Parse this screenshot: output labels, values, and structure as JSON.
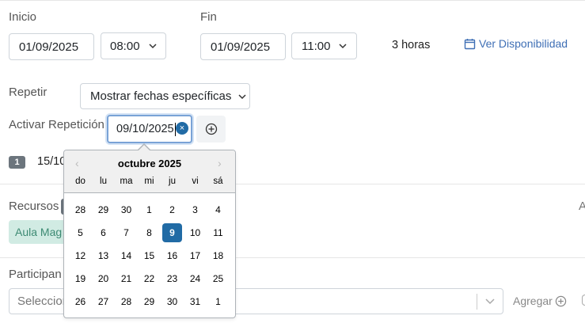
{
  "start": {
    "label": "Inicio",
    "date": "01/09/2025",
    "time": "08:00"
  },
  "end": {
    "label": "Fin",
    "date": "01/09/2025",
    "time": "11:00"
  },
  "duration": "3 horas",
  "availability_link": "Ver Disponibilidad",
  "repeat": {
    "label": "Repetir",
    "mode": "Mostrar fechas específicas"
  },
  "activate_repeat": {
    "label": "Activar Repetición",
    "date_value": "09/10/2025"
  },
  "repeat_list": {
    "count": "1",
    "first_date_partial": "15/10"
  },
  "resources": {
    "label": "Recursos",
    "tag": "Aula Mag",
    "right_cut": "A"
  },
  "participants": {
    "label": "Participan",
    "placeholder": "Seleccion",
    "add_label": "Agregar"
  },
  "datepicker": {
    "month_label": "octubre 2025",
    "weekdays": [
      "do",
      "lu",
      "ma",
      "mi",
      "ju",
      "vi",
      "sá"
    ],
    "weeks": [
      [
        "28",
        "29",
        "30",
        "1",
        "2",
        "3",
        "4"
      ],
      [
        "5",
        "6",
        "7",
        "8",
        "9",
        "10",
        "11"
      ],
      [
        "12",
        "13",
        "14",
        "15",
        "16",
        "17",
        "18"
      ],
      [
        "19",
        "20",
        "21",
        "22",
        "23",
        "24",
        "25"
      ],
      [
        "26",
        "27",
        "28",
        "29",
        "30",
        "31",
        "1"
      ]
    ],
    "selected_day": "9"
  },
  "colors": {
    "accent": "#216ba5",
    "link": "#3f6fb5",
    "tag_bg": "#d1ebe3",
    "tag_text": "#3d8a73"
  }
}
